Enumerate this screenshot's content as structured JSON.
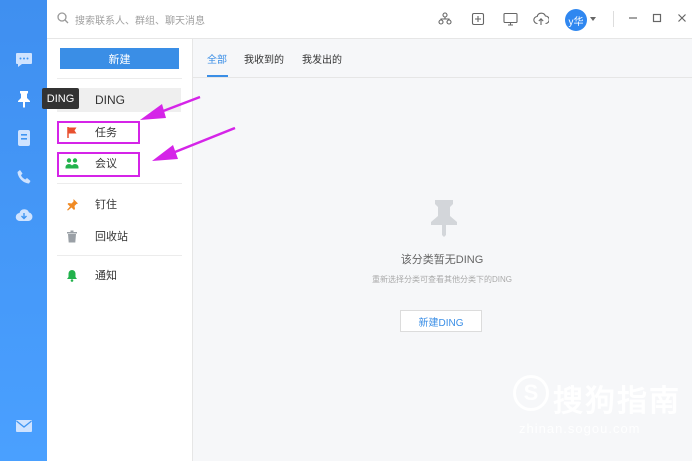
{
  "search": {
    "placeholder": "搜索联系人、群组、聊天消息"
  },
  "user": {
    "avatar_text": "y华"
  },
  "tooltip": "DING",
  "sidebar": {
    "new_button": "新建",
    "items": [
      {
        "label": "DING",
        "icon": "pin-icon"
      },
      {
        "label": "任务",
        "icon": "flag-icon",
        "color": "#e8502f"
      },
      {
        "label": "会议",
        "icon": "meeting-icon",
        "color": "#22b24c"
      },
      {
        "label": "钉住",
        "icon": "pushpin-icon",
        "color": "#f08a24"
      },
      {
        "label": "回收站",
        "icon": "trash-icon",
        "color": "#9aa0a6"
      },
      {
        "label": "通知",
        "icon": "bell-icon",
        "color": "#22b24c"
      }
    ]
  },
  "tabs": [
    {
      "label": "全部",
      "active": true
    },
    {
      "label": "我收到的"
    },
    {
      "label": "我发出的"
    }
  ],
  "empty": {
    "title": "该分类暂无DING",
    "subtitle": "重新选择分类可查看其他分类下的DING",
    "button": "新建DING"
  },
  "watermark": {
    "brand": "搜狗指南",
    "logo_letter": "S",
    "url": "zhinan.sogou.com"
  },
  "colors": {
    "accent": "#3a8ee6",
    "rail": "#4096f2",
    "highlight": "#d524e8"
  }
}
